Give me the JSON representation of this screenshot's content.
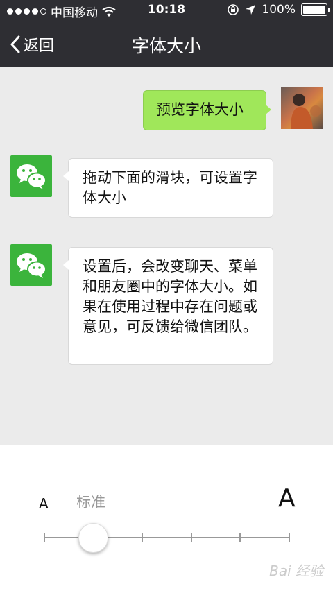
{
  "status_bar": {
    "carrier": "中国移动",
    "time": "10:18",
    "battery": "100%",
    "battery_level": 1.0,
    "signal_icon": "signal-dots",
    "wifi_icon": "wifi-icon",
    "lock_icon": "rotation-lock-icon",
    "location_icon": "location-arrow-icon"
  },
  "nav": {
    "back_label": "返回",
    "title": "字体大小"
  },
  "chat": {
    "preview_bubble": "预览字体大小",
    "message_1": "拖动下面的滑块，可设置字体大小",
    "message_2": "设置后，会改变聊天、菜单和朋友圈中的字体大小。如果在使用过程中存在问题或意见，可反馈给微信团队。"
  },
  "font_size": {
    "small_label": "A",
    "standard_label": "标准",
    "large_label": "A",
    "selected_step": 2,
    "step_count": 6
  },
  "watermark": "Bai 经验",
  "colors": {
    "nav_background": "#2e2e33",
    "chat_background": "#ebebeb",
    "bubble_green": "#a0e75a",
    "wechat_green": "#3bb43c"
  }
}
